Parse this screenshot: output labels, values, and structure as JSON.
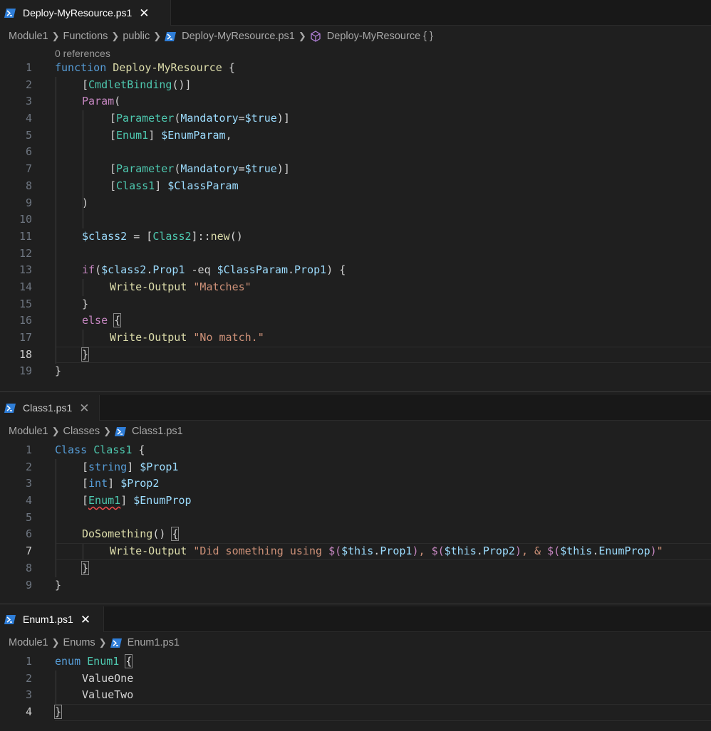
{
  "panes": [
    {
      "tab": {
        "label": "Deploy-MyResource.ps1",
        "close": "✕"
      },
      "breadcrumb": [
        "Module1",
        "Functions",
        "public",
        "Deploy-MyResource.ps1",
        "Deploy-MyResource { }"
      ],
      "codelens": "0 references",
      "line_numbers": [
        "1",
        "2",
        "3",
        "4",
        "5",
        "6",
        "7",
        "8",
        "9",
        "10",
        "11",
        "12",
        "13",
        "14",
        "15",
        "16",
        "17",
        "18",
        "19"
      ]
    },
    {
      "tab": {
        "label": "Class1.ps1",
        "close": "✕"
      },
      "breadcrumb": [
        "Module1",
        "Classes",
        "Class1.ps1"
      ],
      "line_numbers": [
        "1",
        "2",
        "3",
        "4",
        "5",
        "6",
        "7",
        "8",
        "9"
      ]
    },
    {
      "tab": {
        "label": "Enum1.ps1",
        "close": "✕"
      },
      "breadcrumb": [
        "Module1",
        "Enums",
        "Enum1.ps1"
      ],
      "line_numbers": [
        "1",
        "2",
        "3",
        "4"
      ]
    }
  ],
  "code": {
    "p1": {
      "l1": [
        "function",
        " ",
        "Deploy-MyResource",
        " {"
      ],
      "l2": [
        "[",
        "CmdletBinding",
        "()]"
      ],
      "l3": [
        "Param",
        "("
      ],
      "l4": [
        "[",
        "Parameter",
        "(",
        "Mandatory",
        "=",
        "$true",
        ")]"
      ],
      "l5": [
        "[",
        "Enum1",
        "] ",
        "$EnumParam",
        ","
      ],
      "l7": [
        "[",
        "Parameter",
        "(",
        "Mandatory",
        "=",
        "$true",
        ")]"
      ],
      "l8": [
        "[",
        "Class1",
        "] ",
        "$ClassParam"
      ],
      "l9": [
        ")"
      ],
      "l11": [
        "$class2",
        " = [",
        "Class2",
        "]::",
        "new",
        "()"
      ],
      "l13": [
        "if",
        "(",
        "$class2",
        ".",
        "Prop1",
        " -eq ",
        "$ClassParam",
        ".",
        "Prop1",
        ") {"
      ],
      "l14": [
        "Write-Output",
        " ",
        "\"Matches\""
      ],
      "l15": [
        "}"
      ],
      "l16": [
        "else",
        " ",
        "{"
      ],
      "l17": [
        "Write-Output",
        " ",
        "\"No match.\""
      ],
      "l18": [
        "}"
      ],
      "l19": [
        "}"
      ]
    },
    "p2": {
      "l1": [
        "Class",
        " ",
        "Class1",
        " {"
      ],
      "l2": [
        "[",
        "string",
        "] ",
        "$Prop1"
      ],
      "l3": [
        "[",
        "int",
        "] ",
        "$Prop2"
      ],
      "l4": [
        "[",
        "Enum1",
        "] ",
        "$EnumProp"
      ],
      "l6": [
        "DoSomething",
        "() ",
        "{"
      ],
      "l7": [
        "Write-Output",
        " ",
        "\"Did something using ",
        "$(",
        "$this",
        ".",
        "Prop1",
        ")",
        ", ",
        "$(",
        "$this",
        ".",
        "Prop2",
        ")",
        ", & ",
        "$(",
        "$this",
        ".",
        "EnumProp",
        ")",
        "\""
      ],
      "l8": [
        "}"
      ],
      "l9": [
        "}"
      ]
    },
    "p3": {
      "l1": [
        "enum",
        " ",
        "Enum1",
        " ",
        "{"
      ],
      "l2": [
        "ValueOne"
      ],
      "l3": [
        "ValueTwo"
      ],
      "l4": [
        "}"
      ]
    }
  },
  "colors": {
    "background": "#1f1f1f",
    "keyword": "#569cd6",
    "control": "#c586c0",
    "function": "#dcdcaa",
    "variable": "#9cdcfe",
    "type": "#4ec9b0",
    "string": "#ce9178",
    "powershell_icon": "#2f7ed8"
  },
  "icons": [
    "powershell-file-icon",
    "close-icon",
    "chevron-right-icon",
    "symbol-function-icon"
  ]
}
